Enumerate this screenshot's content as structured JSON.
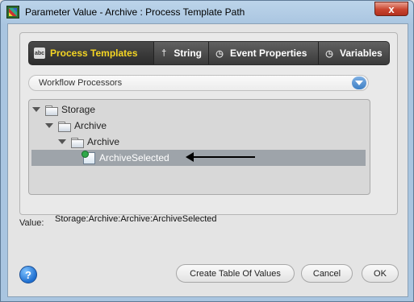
{
  "window": {
    "title": "Parameter Value - Archive : Process Template Path",
    "close_label": "x"
  },
  "tabs": [
    {
      "label": "Process Templates",
      "active": true,
      "icon": "abc-icon"
    },
    {
      "label": "String",
      "active": false,
      "icon": "pin-icon"
    },
    {
      "label": "Event Properties",
      "active": false,
      "icon": "clock-icon"
    },
    {
      "label": "Variables",
      "active": false,
      "icon": "clock-icon"
    }
  ],
  "dropdown": {
    "selected": "Workflow Processors"
  },
  "tree": {
    "nodes": [
      {
        "label": "Storage",
        "level": 0,
        "expanded": true
      },
      {
        "label": "Archive",
        "level": 1,
        "expanded": true
      },
      {
        "label": "Archive",
        "level": 2,
        "expanded": true
      },
      {
        "label": "ArchiveSelected",
        "level": 3,
        "selected": true
      }
    ]
  },
  "value": {
    "label": "Value:",
    "text": "Storage:Archive:Archive:ArchiveSelected"
  },
  "buttons": {
    "help": "?",
    "create": "Create Table Of Values",
    "cancel": "Cancel",
    "ok": "OK"
  },
  "colors": {
    "active_tab_text": "#f4d523",
    "selection": "#9ea4aa"
  }
}
